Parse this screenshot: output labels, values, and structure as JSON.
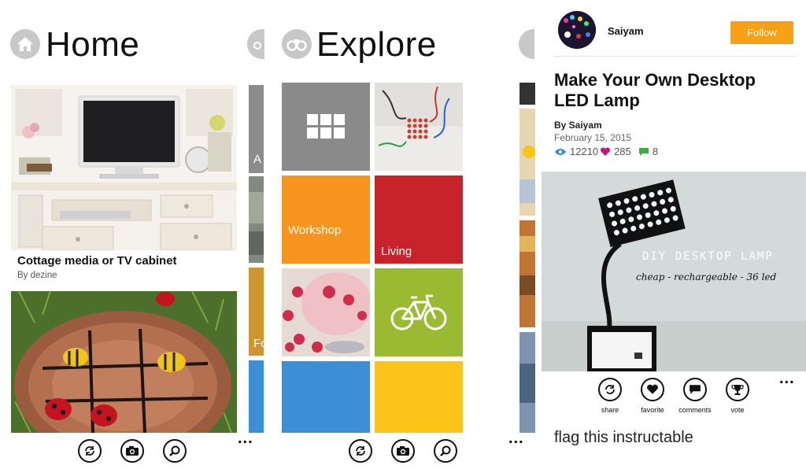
{
  "home": {
    "title": "Home",
    "cards": [
      {
        "title": "Cottage media or TV cabinet",
        "author": "By dezine"
      }
    ],
    "strips": [
      {
        "label": "A"
      },
      {
        "label": "Fo"
      }
    ],
    "icons": {
      "header": "house-icon",
      "peek": "binoculars-icon"
    }
  },
  "explore": {
    "title": "Explore",
    "tiles": [
      {
        "label": "",
        "color": "#8a8a8a",
        "icon": "grid-icon"
      },
      {
        "label": "",
        "color": "#dcdcd8",
        "icon": "photo"
      },
      {
        "label": "Workshop",
        "color": "#f7941d"
      },
      {
        "label": "Living",
        "color": "#c8222a"
      },
      {
        "label": "",
        "color": "#f2b5b9",
        "icon": "photo"
      },
      {
        "label": "",
        "color": "#9aba32",
        "icon": "bicycle-icon"
      },
      {
        "label": "",
        "color": "#3d8fd5"
      },
      {
        "label": "",
        "color": "#fcc419"
      }
    ],
    "icons": {
      "header": "binoculars-icon"
    }
  },
  "appbar": {
    "buttons": [
      "refresh-icon",
      "camera-icon",
      "search-icon"
    ],
    "more": "..."
  },
  "detail": {
    "username": "Saiyam",
    "follow_label": "Follow",
    "title": "Make Your Own Desktop LED Lamp",
    "byline": "By Saiyam",
    "date": "February 15, 2015",
    "stats": {
      "views": "12210",
      "favorites": "285",
      "comments": "8"
    },
    "image_text": {
      "line1": "DIY DESKTOP LAMP",
      "line2": "cheap - rechargeable - 36 led"
    },
    "actions": [
      {
        "label": "share",
        "icon": "share-icon"
      },
      {
        "label": "favorite",
        "icon": "heart-icon"
      },
      {
        "label": "comments",
        "icon": "comment-icon"
      },
      {
        "label": "vote",
        "icon": "trophy-icon"
      }
    ],
    "more": "...",
    "flag_label": "flag this instructable"
  },
  "colors": {
    "accent_orange": "#f8a018",
    "views_blue": "#1a8fbf",
    "fav_pink": "#c2187a",
    "comment_green": "#3fae3f"
  }
}
